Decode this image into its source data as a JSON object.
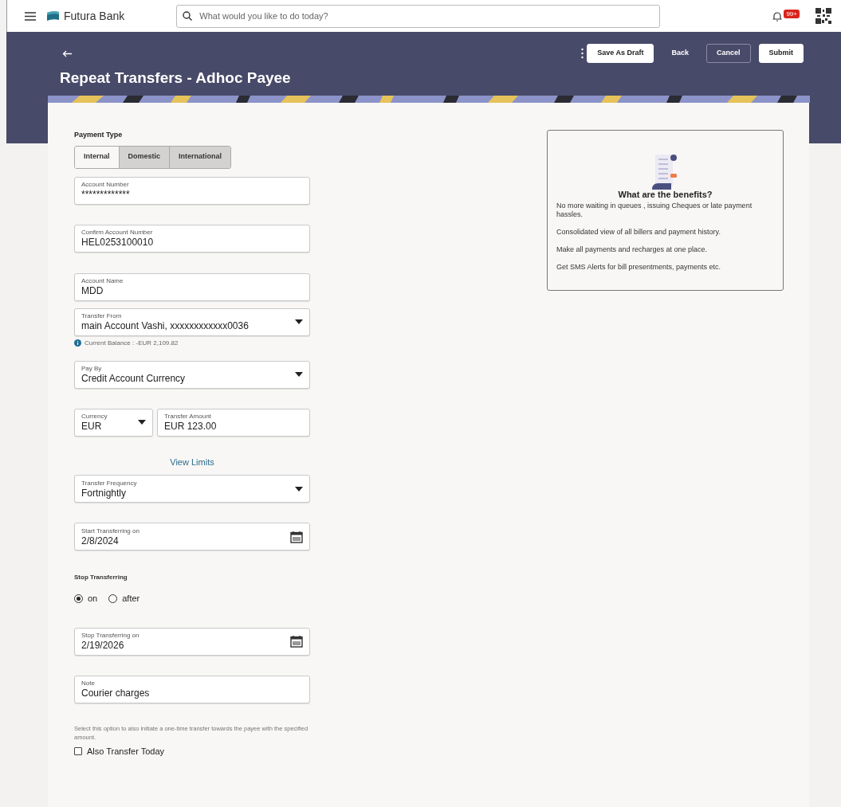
{
  "header": {
    "brand": "Futura Bank",
    "search": {
      "placeholder": "What would you like to do today?"
    },
    "notification_badge": "99+"
  },
  "page": {
    "title": "Repeat Transfers - Adhoc Payee",
    "actions": [
      {
        "label": "Save As Draft",
        "kind": "outlined"
      },
      {
        "label": "Back",
        "kind": "plain"
      },
      {
        "label": "Cancel",
        "kind": "dark"
      },
      {
        "label": "Submit",
        "kind": "outlined"
      }
    ]
  },
  "form": {
    "payment_type": {
      "label": "Payment Type",
      "options": [
        {
          "label": "Internal",
          "selected": true
        },
        {
          "label": "Domestic",
          "selected": false
        },
        {
          "label": "International",
          "selected": false
        }
      ]
    },
    "items": [
      {
        "kind": "field",
        "label": "Account Number",
        "value": "*************"
      },
      {
        "kind": "field",
        "label": "Confirm Account Number",
        "value": "HEL0253100010"
      },
      {
        "kind": "field",
        "label": "Account Name",
        "value": "MDD"
      },
      {
        "kind": "select",
        "label": "Transfer From",
        "value": "main Account Vashi, xxxxxxxxxxxx0036",
        "hint": "Current Balance : -EUR 2,109.82"
      },
      {
        "kind": "select",
        "label": "Pay By",
        "value": "Credit Account Currency"
      },
      {
        "kind": "pair",
        "left": {
          "label": "Currency",
          "value": "EUR"
        },
        "right": {
          "label": "Transfer Amount",
          "value": "EUR 123.00"
        }
      },
      {
        "kind": "link",
        "label": "View Limits"
      },
      {
        "kind": "select",
        "label": "Transfer Frequency",
        "value": "Fortnightly"
      },
      {
        "kind": "date",
        "label": "Start Transferring on",
        "value": "2/8/2024"
      },
      {
        "kind": "radio",
        "label": "Stop Transferring",
        "options": [
          {
            "label": "on",
            "selected": true
          },
          {
            "label": "after",
            "selected": false
          }
        ]
      },
      {
        "kind": "date",
        "label": "Stop Transferring on",
        "value": "2/19/2026"
      },
      {
        "kind": "field",
        "label": "Note",
        "value": "Courier charges"
      },
      {
        "kind": "checkbox",
        "help": "Select this option to also initiate a one-time transfer towards the payee with the specified amount.",
        "label": "Also Transfer Today",
        "checked": false
      }
    ]
  },
  "benefits": {
    "title": "What are the benefits?",
    "points": [
      "No more waiting in queues , issuing Cheques or late payment hassles.",
      "Consolidated view of all billers and payment history.",
      "Make all payments and recharges at one place.",
      "Get SMS Alerts for bill presentments, payments etc."
    ]
  }
}
